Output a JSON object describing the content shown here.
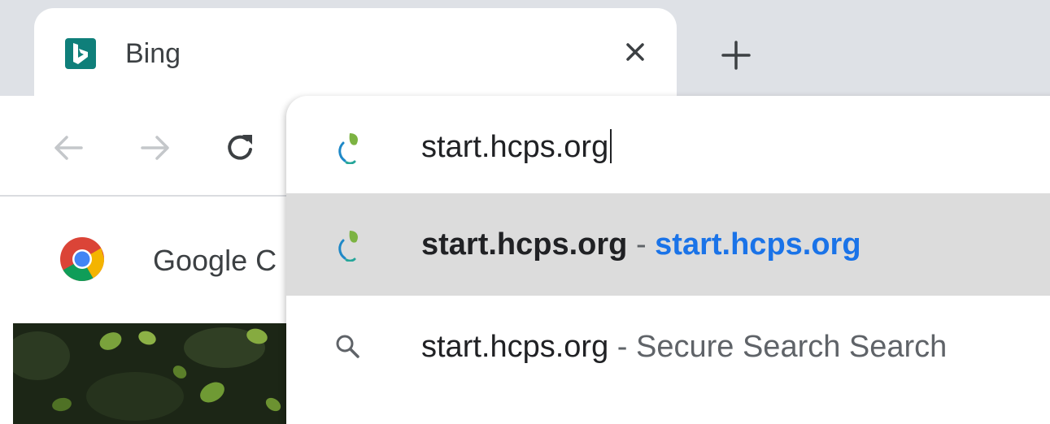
{
  "tab": {
    "title": "Bing",
    "favicon": "bing-icon",
    "close": "close-icon"
  },
  "new_tab": "plus-icon",
  "toolbar": {
    "back": "arrow-left-icon",
    "forward": "arrow-right-icon",
    "reload": "reload-icon"
  },
  "bookmarks": {
    "items": [
      {
        "label": "Google C",
        "icon": "chrome-icon"
      }
    ]
  },
  "omnibox": {
    "input_value": "start.hcps.org",
    "input_icon": "hcps-leaf-icon",
    "suggestions": [
      {
        "title": "start.hcps.org",
        "separator": "-",
        "url": "start.hcps.org",
        "icon": "hcps-leaf-icon"
      },
      {
        "title": "start.hcps.org",
        "separator": "-",
        "description": "Secure Search Search",
        "icon": "search-icon"
      }
    ]
  },
  "colors": {
    "tabstrip": "#dee1e6",
    "accent_link": "#1a73e8",
    "selected_row": "#dcdcdc",
    "bing_brand": "#0f7f7a"
  }
}
